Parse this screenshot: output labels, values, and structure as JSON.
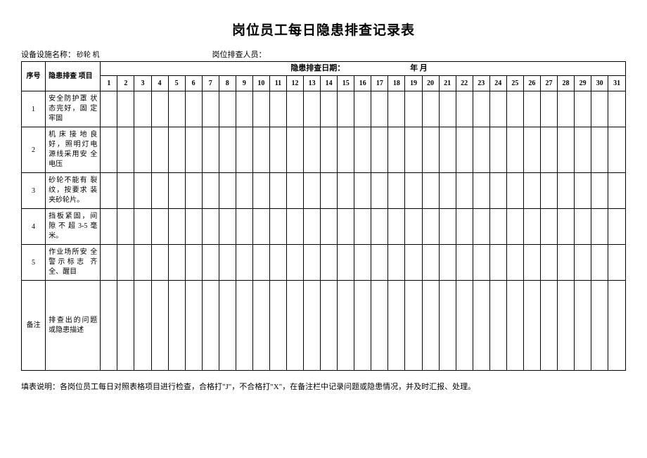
{
  "title": "岗位员工每日隐患排查记录表",
  "meta": {
    "equipment_label": "设备设施名称：",
    "equipment_value": "砂轮 机",
    "inspector_label": "岗位排查人员：",
    "date_label": "隐患排查日期：",
    "date_ym": "年  月"
  },
  "headers": {
    "seq": "序号",
    "item": "隐患排查  项目",
    "remark": "备注"
  },
  "days": [
    "1",
    "2",
    "3",
    "4",
    "5",
    "6",
    "7",
    "8",
    "9",
    "10",
    "11",
    "12",
    "13",
    "14",
    "15",
    "16",
    "17",
    "18",
    "19",
    "20",
    "21",
    "22",
    "23",
    "24",
    "25",
    "26",
    "27",
    "28",
    "29",
    "30",
    "31"
  ],
  "rows": [
    {
      "seq": "1",
      "item": "安全防护罩   状态完好，固   定牢固"
    },
    {
      "seq": "2",
      "item": "机床接地良  好，照明灯电    源线采用安   全电压"
    },
    {
      "seq": "3",
      "item": "砂轮不能有    裂纹，按要求   装夹砂轮片。"
    },
    {
      "seq": "4",
      "item": "挡板紧固，间    隙不超3-5毫  米。"
    },
    {
      "seq": "5",
      "item": "作业场所安    全警示标志   齐全、醒目"
    }
  ],
  "remark_item": "排查出的问题或隐患描述",
  "footer": "填表说明：各岗位员工每日对照表格项目进行检查，合格打\"J\"，不合格打\"X\"，在备注栏中记录问题或隐患情况，并及时汇报、处理。"
}
